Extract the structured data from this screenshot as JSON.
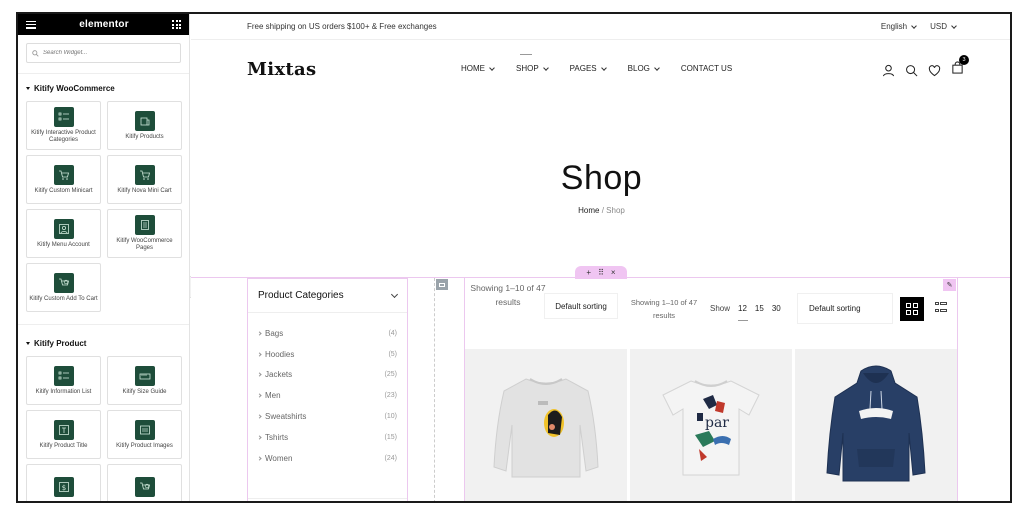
{
  "editor": {
    "brand": "elementor",
    "search_placeholder": "Search Widget...",
    "collapse_glyph": "‹",
    "categories": [
      {
        "title": "Kitify WooCommerce",
        "widgets": [
          {
            "label": "Kitify Interactive Product Categories",
            "icon": "list-icon"
          },
          {
            "label": "Kitify Products",
            "icon": "products-icon"
          },
          {
            "label": "Kitify Custom Minicart",
            "icon": "cart-icon"
          },
          {
            "label": "Kitify Nova Mini Cart",
            "icon": "cart-icon"
          },
          {
            "label": "Kitify Menu Account",
            "icon": "account-icon"
          },
          {
            "label": "Kitify WooCommerce Pages",
            "icon": "page-icon"
          },
          {
            "label": "Kitify Custom Add To Cart",
            "icon": "add-to-cart-icon"
          }
        ]
      },
      {
        "title": "Kitify Product",
        "widgets": [
          {
            "label": "Kitify Information List",
            "icon": "list-icon"
          },
          {
            "label": "Kitify Size Guide",
            "icon": "ruler-icon"
          },
          {
            "label": "Kitify Product Title",
            "icon": "title-icon"
          },
          {
            "label": "Kitify Product Images",
            "icon": "images-icon"
          },
          {
            "label": "",
            "icon": "dollar-icon"
          },
          {
            "label": "",
            "icon": "add-to-cart-icon"
          }
        ]
      }
    ],
    "handle": {
      "add": "+",
      "move": "⠿",
      "close": "×"
    },
    "edit_glyph": "✎"
  },
  "site": {
    "topbar": {
      "promo": "Free shipping on US orders $100+ & Free exchanges",
      "language": "English",
      "currency": "USD"
    },
    "logo": "Mixtas",
    "nav": [
      {
        "label": "HOME",
        "has_dropdown": true
      },
      {
        "label": "SHOP",
        "has_dropdown": true,
        "active": true
      },
      {
        "label": "PAGES",
        "has_dropdown": true
      },
      {
        "label": "BLOG",
        "has_dropdown": true
      },
      {
        "label": "CONTACT US",
        "has_dropdown": false
      }
    ],
    "cart_count": "3",
    "hero": {
      "title": "Shop",
      "breadcrumb_home": "Home",
      "breadcrumb_sep": " / ",
      "breadcrumb_current": "Shop"
    },
    "categories_widget": {
      "title": "Product Categories",
      "items": [
        {
          "name": "Bags",
          "count": "(4)"
        },
        {
          "name": "Hoodies",
          "count": "(5)"
        },
        {
          "name": "Jackets",
          "count": "(25)"
        },
        {
          "name": "Men",
          "count": "(23)"
        },
        {
          "name": "Sweatshirts",
          "count": "(10)"
        },
        {
          "name": "Tshirts",
          "count": "(15)"
        },
        {
          "name": "Women",
          "count": "(24)"
        }
      ]
    },
    "toolbar": {
      "results_primary": "Showing 1–10 of 47 results",
      "sorting_primary": "Default sorting",
      "results_secondary": "Showing 1–10 of 47 results",
      "show_label": "Show",
      "per_page": [
        "12",
        "15",
        "30"
      ],
      "sorting_secondary": "Default sorting"
    },
    "products": [
      {
        "image": "sweatshirt-image",
        "color": "#e2e2e2"
      },
      {
        "image": "tshirt-image",
        "color": "#f4f4f4"
      },
      {
        "image": "hoodie-image",
        "color": "#283f66"
      }
    ]
  }
}
